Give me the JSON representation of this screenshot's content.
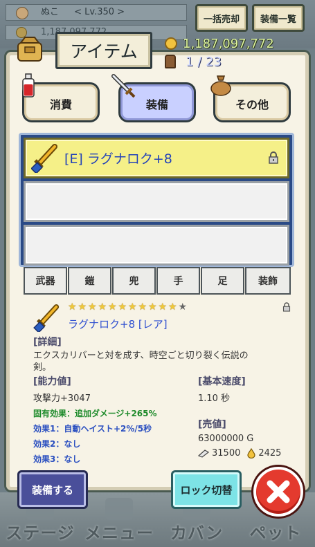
{
  "header": {
    "player_name": "ぬこ",
    "player_level": "< Lv.350 >",
    "bg_gold": "1,187,097,772",
    "bulk_sell_label": "一括売却",
    "equip_list_label": "装備一覧"
  },
  "panel": {
    "title": "アイテム",
    "gold": "1,187,097,772",
    "capacity": "1 / 23"
  },
  "categories": [
    {
      "label": "消費"
    },
    {
      "label": "装備"
    },
    {
      "label": "その他"
    }
  ],
  "items": [
    {
      "name": "[E] ラグナロク+8",
      "locked": true
    }
  ],
  "equip_tabs": [
    "武器",
    "鎧",
    "兜",
    "手",
    "足",
    "装飾"
  ],
  "detail": {
    "stars_filled": 11,
    "stars_total": 12,
    "title": "ラグナロク+8 [レア]",
    "desc_heading": "[詳細]",
    "desc_line1": "エクスカリバーと対を成す、時空ごと切り裂く伝説の",
    "desc_line2": "剣。",
    "stats_heading": "[能力値]",
    "attack": "攻撃力+3047",
    "speed_heading": "[基本速度]",
    "speed": "1.10 秒",
    "unique_effect": "固有効果：追加ダメージ+265%",
    "effect1": "効果1：自動ヘイスト+2%/5秒",
    "effect2": "効果2：なし",
    "effect3": "効果3：なし",
    "price_heading": "[売値]",
    "price": "63000000 G",
    "stone_count": "31500",
    "drop_count": "2425"
  },
  "buttons": {
    "equip": "装備する",
    "lock_toggle": "ロック切替"
  },
  "bottom_nav": [
    "ステージ",
    "メニュー",
    "カバン",
    "ペット"
  ],
  "colors": {
    "gold_text": "#dff5a0",
    "item_name": "#2443b8",
    "selected_slot": "#f5f088",
    "unique_effect": "#1d8a2a",
    "effect": "#2a4fc0",
    "close_button": "#e43a2e"
  }
}
